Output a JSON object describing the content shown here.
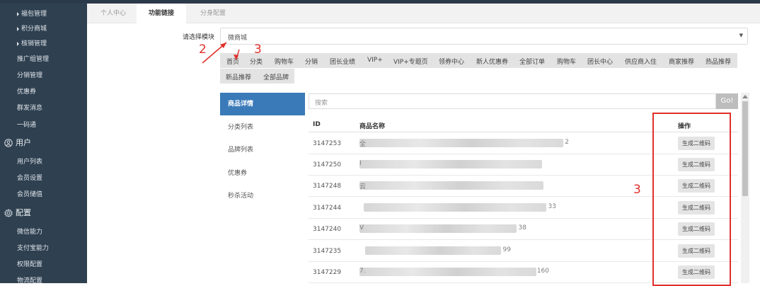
{
  "sidebar": {
    "items": [
      {
        "label": "福包管理",
        "kind": "sub"
      },
      {
        "label": "积分商城",
        "kind": "sub"
      },
      {
        "label": "核销管理",
        "kind": "sub"
      },
      {
        "label": "推广组管理",
        "kind": "child"
      },
      {
        "label": "分销管理",
        "kind": "child"
      },
      {
        "label": "优惠券",
        "kind": "child"
      },
      {
        "label": "群发消息",
        "kind": "child"
      },
      {
        "label": "一码通",
        "kind": "child"
      }
    ],
    "group_user": {
      "label": "用户",
      "icon": "user-icon"
    },
    "user_items": [
      "用户列表",
      "会员设置",
      "会员储值"
    ],
    "group_config": {
      "label": "配置",
      "icon": "gear-icon"
    },
    "config_items": [
      "微信能力",
      "支付宝能力",
      "权限配置",
      "物流配置"
    ]
  },
  "tabs": [
    "个人中心",
    "功能链接",
    "分身配置"
  ],
  "active_tab": "功能链接",
  "module_label": "请选择模块",
  "module_select": {
    "value": "微商城"
  },
  "links_row1": [
    "首页",
    "分类",
    "购物车",
    "分销",
    "团长业绩",
    "VIP+",
    "VIP+专题页",
    "领券中心",
    "新人优惠券",
    "全部订单",
    "购物车",
    "团长中心",
    "供应商入住",
    "商家推荐",
    "热品推荐"
  ],
  "links_row2": [
    "新品推荐",
    "全部品牌"
  ],
  "annotations": {
    "n2": "2",
    "n3_top": "3",
    "n3_right": "3"
  },
  "left_menu": [
    "商品详情",
    "分类列表",
    "品牌列表",
    "优惠券",
    "秒杀活动"
  ],
  "search": {
    "placeholder": "搜索",
    "button": "Go!"
  },
  "table": {
    "headers": {
      "id": "ID",
      "name": "商品名称",
      "action": "操作"
    },
    "rows": [
      {
        "id": "3147253",
        "name_head": "全",
        "name_tail": "2",
        "action": "生成二维码"
      },
      {
        "id": "3147250",
        "name_head": "I",
        "name_tail": "",
        "action": "生成二维码"
      },
      {
        "id": "3147248",
        "name_head": "云",
        "name_tail": "",
        "action": "生成二维码"
      },
      {
        "id": "3147244",
        "name_head": "",
        "name_tail": "33",
        "action": "生成二维码"
      },
      {
        "id": "3147240",
        "name_head": "V",
        "name_tail": "38",
        "action": "生成二维码"
      },
      {
        "id": "3147235",
        "name_head": "",
        "name_tail": "99",
        "action": "生成二维码"
      },
      {
        "id": "3147229",
        "name_head": "7.",
        "name_tail": "160",
        "action": "生成二维码"
      }
    ]
  },
  "colors": {
    "sidebar": "#2f4050",
    "accent": "#3a7ab8",
    "annotation": "#e0302a"
  }
}
